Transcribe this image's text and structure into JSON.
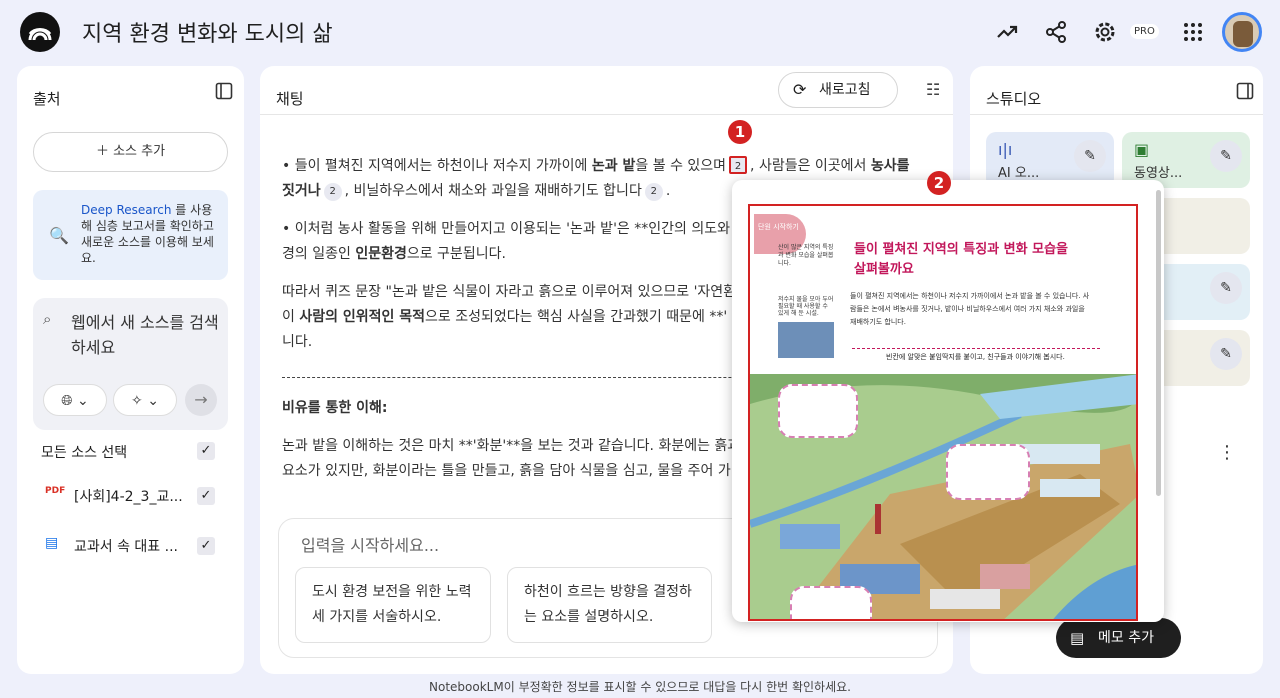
{
  "app": {
    "title": "지역 환경 변화와 도시의 삶",
    "pro_label": "PRO"
  },
  "sources": {
    "title": "출처",
    "add_label": "소스 추가",
    "research_link": "Deep Research",
    "research_text": " 를 사용해 심층 보고서를 확인하고 새로운 소스를 이용해 보세요.",
    "search_placeholder": "웹에서 새 소스를 검색하세요",
    "select_all": "모든 소스 선택",
    "items": [
      {
        "name": "[사회]4-2_3_교...",
        "icon": "pdf-icon"
      },
      {
        "name": "교과서 속 대표 ...",
        "icon": "document-icon"
      }
    ]
  },
  "chat": {
    "title": "채팅",
    "refresh_label": "새로고침",
    "p1a": "• 들이 펼쳐진 지역에서는 하천이나 저수지 가까이에 ",
    "p1b": "논과 밭",
    "p1c": "을 볼 수 있으며",
    "p1d": ", 사람들은 이곳에서 ",
    "p1e": "농사를 짓거나",
    "p1f": ", 비닐하우스에서 채소와 과일을 재배하기도 합니다",
    "cite_num": "2",
    "p2a": "• 이처럼 농사 활동을 위해 만들어지고 이용되는 '논과 밭'은 **인간의 의도와 ",
    "p2b": "경의 일종인 ",
    "p2c": "인문환경",
    "p2d": "으로 구분됩니다.",
    "p3a": "따라서 퀴즈 문장 \"논과 밭은 식물이 자라고 흙으로 이루어져 있으므로 '자연환",
    "p3b": "이 ",
    "p3c": "사람의 인위적인 목적",
    "p3d": "으로 조성되었다는 핵심 사실을 간과했기 때문에 **'",
    "p3e": "니다.",
    "heading": "비유를 통한 이해:",
    "p4a": "논과 밭을 이해하는 것은 마치 **'화분'**을 보는 것과 같습니다. 화분에는 흙과",
    "p4b": "요소가 있지만, 화분이라는 틀을 만들고, 흙을 담아 식물을 심고, 물을 주어 가",
    "input_placeholder": "입력을 시작하세요...",
    "suggestions": [
      "도시 환경 보전을 위한 노력 세 가지를 서술하시오.",
      "하천이 흐르는 방향을 결정하는 요소를 설명하시오."
    ]
  },
  "studio": {
    "title": "스튜디오",
    "tiles": [
      {
        "label": "AI 오...",
        "icon": "audio-icon"
      },
      {
        "label": "동영상...",
        "icon": "video-icon"
      }
    ],
    "memo_label": "메모 추가"
  },
  "popup": {
    "header": "단원 시작하기",
    "title": "들이 펼쳐진 지역의 특징과 변화 모습을 살펴볼까요",
    "side_text": "산이 많은 지역의 특징과 변화 모습을 살펴봅니다.",
    "photo_caption": "저수지 물을 모아 두어 필요할 때 사용할 수 있게 해 둔 시설.",
    "body": "들이 펼쳐진 지역에서는 하천이나 저수지 가까이에서 논과 밭을 볼 수 있습니다. 사람들은 논에서 벼농사를 짓거나, 밭이나 비닐하우스에서 여러 가지 채소와 과일을 재배하기도 합니다.",
    "activity": "빈칸에 알맞은 붙임딱지를 붙이고, 친구들과 이야기해 봅시다."
  },
  "annotations": {
    "badge1": "1",
    "badge2": "2"
  },
  "footer": "NotebookLM이 부정확한 정보를 표시할 수 있으므로 대답을 다시 한번 확인하세요.",
  "colors": {
    "accent_red": "#d32222",
    "bg": "#eef0fb",
    "studio_blue": "#e3eaf7",
    "studio_green": "#dff0e3"
  }
}
